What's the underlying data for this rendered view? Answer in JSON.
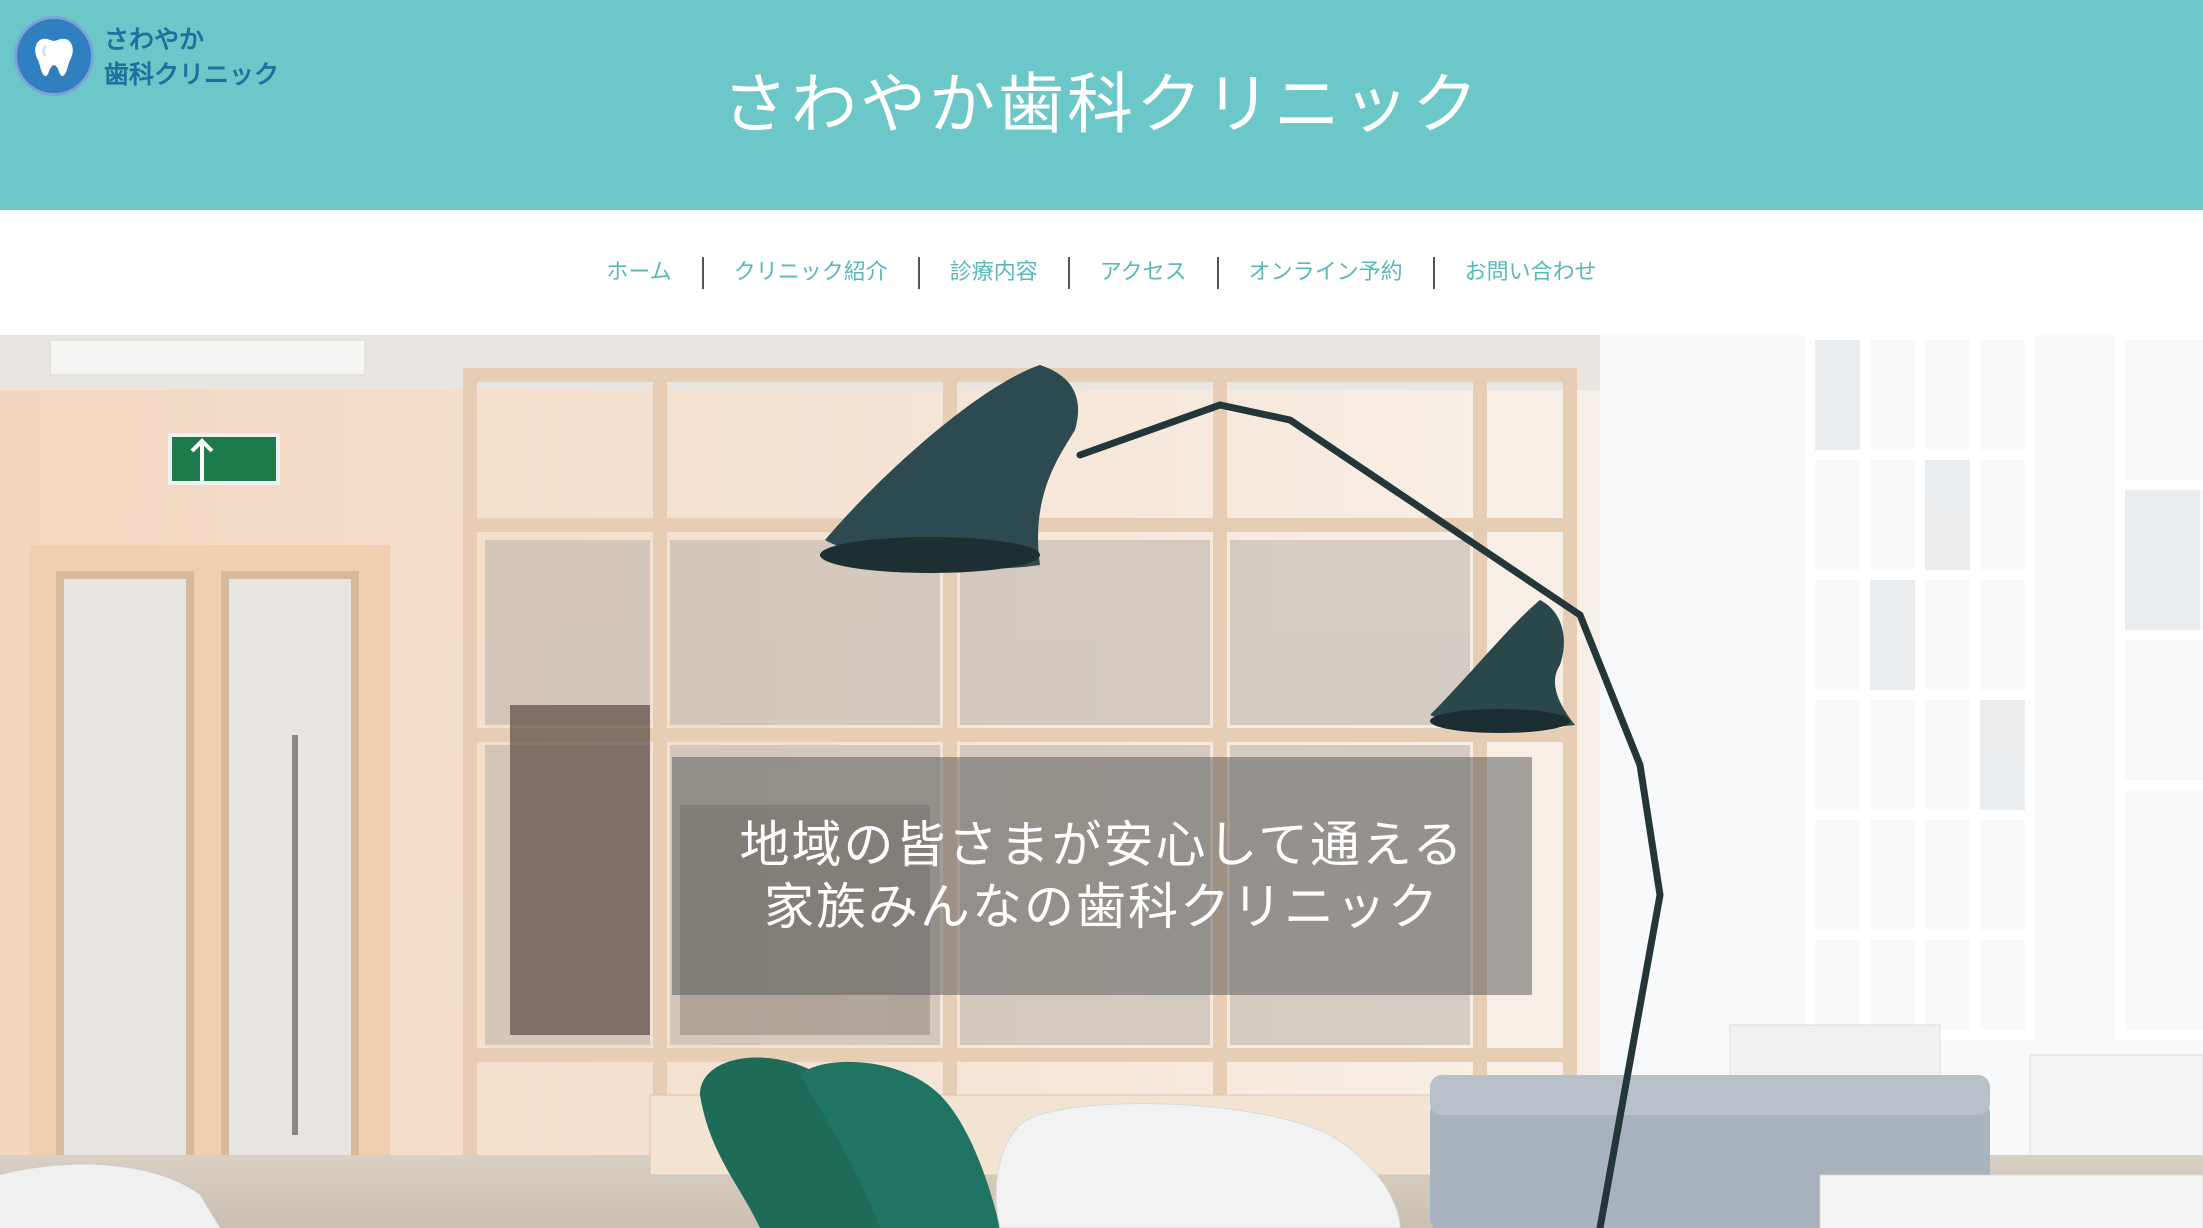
{
  "logo": {
    "text": "さわやか\n歯科クリニック",
    "icon": "tooth-icon"
  },
  "header": {
    "title": "さわやか歯科クリニック"
  },
  "nav": {
    "items": [
      "ホーム",
      "クリニック紹介",
      "診療内容",
      "アクセス",
      "オンライン予約",
      "お問い合わせ"
    ]
  },
  "hero": {
    "line1": "地域の皆さまが安心して通える",
    "line2": "家族みんなの歯科クリニック"
  },
  "colors": {
    "header_bg": "#6cc7c8",
    "nav_text": "#58b9b8",
    "logo_text": "#1f6f9f",
    "caption_bg": "rgba(90,90,90,0.52)"
  }
}
